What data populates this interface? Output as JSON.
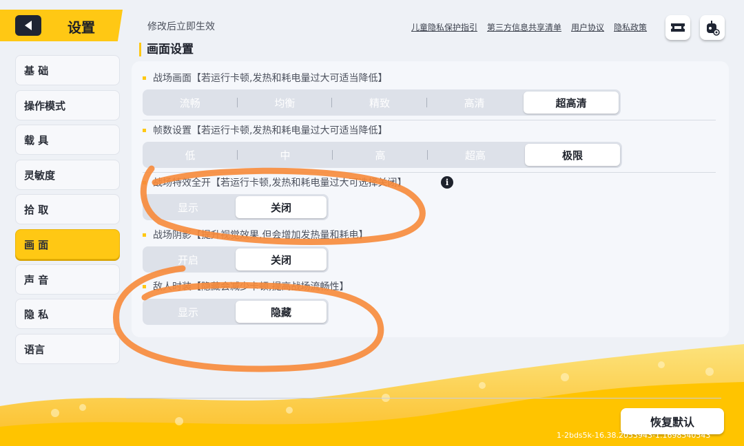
{
  "header": {
    "title": "设置",
    "notice": "修改后立即生效",
    "links": [
      "儿童隐私保护指引",
      "第三方信息共享清单",
      "用户协议",
      "隐私政策"
    ],
    "icons": [
      "ticket-icon",
      "robot-settings-icon"
    ]
  },
  "section_title": "画面设置",
  "sidebar": {
    "items": [
      {
        "label": "基 础",
        "active": false
      },
      {
        "label": "操作模式",
        "active": false
      },
      {
        "label": "载 具",
        "active": false
      },
      {
        "label": "灵敏度",
        "active": false
      },
      {
        "label": "拾 取",
        "active": false
      },
      {
        "label": "画 面",
        "active": true
      },
      {
        "label": "声 音",
        "active": false
      },
      {
        "label": "隐 私",
        "active": false
      },
      {
        "label": "语言",
        "active": false
      }
    ]
  },
  "settings": [
    {
      "label": "战场画面【若运行卡顿,发热和耗电量过大可适当降低】",
      "options": [
        "流畅",
        "均衡",
        "精致",
        "高清",
        "超高清"
      ],
      "selected": 4
    },
    {
      "label": "帧数设置【若运行卡顿,发热和耗电量过大可适当降低】",
      "options": [
        "低",
        "中",
        "高",
        "超高",
        "极限"
      ],
      "selected": 4
    },
    {
      "label": "战场特效全开【若运行卡顿,发热和耗电量过大可选择关闭】",
      "options": [
        "显示",
        "关闭"
      ],
      "selected": 1
    },
    {
      "label": "战场阴影【提升视觉效果,但会增加发热量和耗电】",
      "options": [
        "开启",
        "关闭"
      ],
      "selected": 1
    },
    {
      "label": "敌人时装【隐藏会减少卡顿,提高战场流畅性】",
      "options": [
        "显示",
        "隐藏"
      ],
      "selected": 1
    }
  ],
  "info_glyph": "i",
  "reset_label": "恢复默认",
  "version": "1-2bds5k-16.38.2053943-1.1698540543",
  "colors": {
    "accent": "#ffc814",
    "annotation": "#f7893a"
  }
}
